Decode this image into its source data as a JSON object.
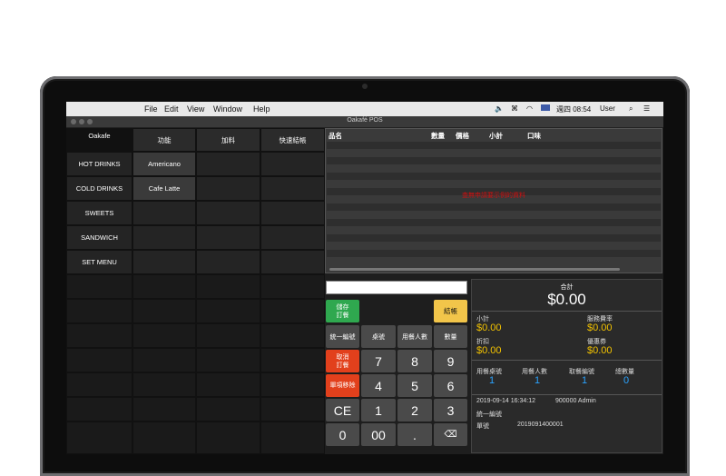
{
  "menubar": {
    "menus": [
      "File",
      "Edit",
      "View",
      "Window",
      "Help"
    ],
    "clock": "週四 08:54",
    "user": "User"
  },
  "window": {
    "title": "Oakafé POS"
  },
  "left_panel": {
    "app_label": "Oakafe",
    "tabs": [
      "功能",
      "加料",
      "快速結帳"
    ],
    "categories": [
      "HOT DRINKS",
      "COLD DRINKS",
      "SWEETS",
      "SANDWICH",
      "SET MENU"
    ],
    "items": [
      "Americano",
      "Cafe Latte"
    ]
  },
  "order_table": {
    "columns": [
      "品名",
      "數量",
      "價格",
      "小計",
      "口味"
    ],
    "empty_message": "查無申請要示例的資料"
  },
  "keypad": {
    "save_order": "儲存\n訂餐",
    "checkout": "結帳",
    "labels": [
      "統一編號",
      "桌號",
      "用餐人數",
      "數量"
    ],
    "cancel_order": "取消\n訂餐",
    "remove_item": "單項移除",
    "clear": "CE",
    "digits": [
      "7",
      "8",
      "9",
      "4",
      "5",
      "6",
      "1",
      "2",
      "3",
      "0",
      "00",
      "."
    ],
    "backspace": "⌫"
  },
  "summary": {
    "total_label": "合計",
    "total_value": "$0.00",
    "subtotal_label": "小計",
    "subtotal_value": "$0.00",
    "service_label": "服務費率",
    "service_value": "$0.00",
    "discount_label": "折扣",
    "discount_value": "$0.00",
    "coupon_label": "優惠券",
    "coupon_value": "$0.00",
    "table_label": "用餐桌號",
    "table_value": "1",
    "guests_label": "用餐人數",
    "guests_value": "1",
    "pickup_label": "取餐編號",
    "pickup_value": "1",
    "qty_label": "總數量",
    "qty_value": "0",
    "datetime": "2019-09-14 16:34:12",
    "staff": "900000 Admin",
    "tax_id_label": "統一編號",
    "order_no_label": "單號",
    "order_no": "2019091400001"
  },
  "colors": {
    "accent_gold": "#f2c200",
    "accent_blue": "#2aa3ff",
    "save_green": "#2fa84f",
    "checkout_yellow": "#f2c54a",
    "cancel_red": "#e2401c"
  }
}
